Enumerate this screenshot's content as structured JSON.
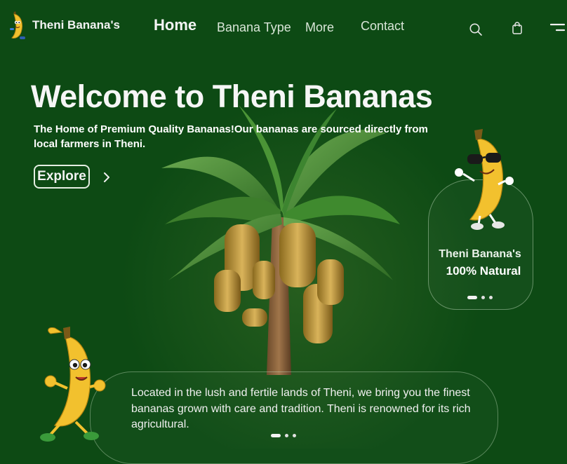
{
  "brand": {
    "name": "Theni Banana's",
    "logo_icon": "banana-mascot-icon"
  },
  "nav": {
    "items": [
      {
        "label": "Home",
        "active": true
      },
      {
        "label": "Banana Type",
        "active": false
      },
      {
        "label": "More",
        "active": false
      },
      {
        "label": "Contact",
        "active": false
      }
    ],
    "icons": [
      "search-icon",
      "shopping-bag-icon",
      "menu-icon"
    ]
  },
  "hero": {
    "title": "Welcome to Theni Bananas",
    "subtitle": "The Home of Premium Quality Bananas!Our bananas are sourced directly from local farmers in Theni.",
    "explore_label": "Explore"
  },
  "side_card": {
    "title": "Theni Banana's",
    "tagline": "100% Natural",
    "slides": 3,
    "active_slide": 0
  },
  "about": {
    "text": "Located in the lush and fertile lands of Theni, we bring you the finest bananas grown with care and tradition. Theni is renowned for its rich agricultural.",
    "slides": 3,
    "active_slide": 0
  },
  "colors": {
    "background": "#0d4a14",
    "banana": "#f2c12e",
    "leaf": "#3f8a2e",
    "text": "#ffffff"
  }
}
